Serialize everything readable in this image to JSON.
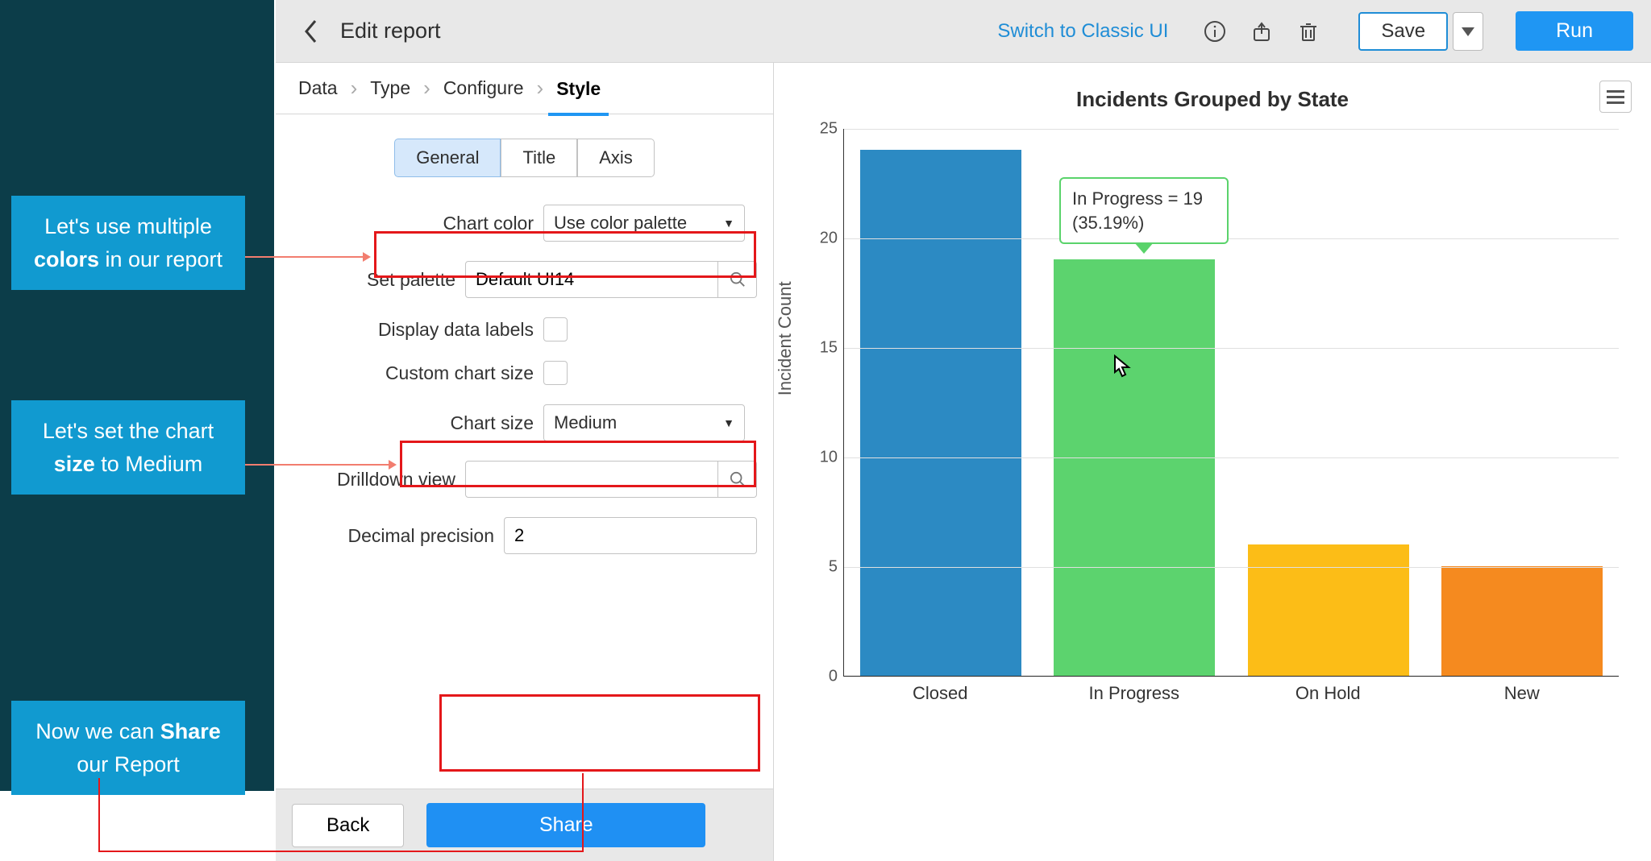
{
  "topbar": {
    "title": "Edit report",
    "classic_link": "Switch to Classic UI",
    "save_label": "Save",
    "run_label": "Run"
  },
  "wizard": {
    "tabs": [
      "Data",
      "Type",
      "Configure",
      "Style"
    ],
    "active": 3
  },
  "sub_tabs": {
    "items": [
      "General",
      "Title",
      "Axis"
    ],
    "active": 0
  },
  "fields": {
    "chart_color_label": "Chart color",
    "chart_color_value": "Use color palette",
    "set_palette_label": "Set palette",
    "set_palette_value": "Default UI14",
    "display_labels_label": "Display data labels",
    "custom_size_label": "Custom chart size",
    "chart_size_label": "Chart size",
    "chart_size_value": "Medium",
    "drilldown_label": "Drilldown view",
    "drilldown_value": "",
    "decimal_label": "Decimal precision",
    "decimal_value": "2"
  },
  "footer": {
    "back_label": "Back",
    "share_label": "Share"
  },
  "chart_title": "Incidents Grouped by State",
  "y_axis": "Incident Count",
  "chart_data": {
    "type": "bar",
    "title": "Incidents Grouped by State",
    "ylabel": "Incident Count",
    "ylim": [
      0,
      25
    ],
    "yticks": [
      0,
      5,
      10,
      15,
      20,
      25
    ],
    "categories": [
      "Closed",
      "In Progress",
      "On Hold",
      "New"
    ],
    "values": [
      24,
      19,
      6,
      5
    ],
    "colors": [
      "#2c8ac3",
      "#5cd36e",
      "#fcbd17",
      "#f58a1f"
    ],
    "tooltip": {
      "index": 1,
      "line1": "In Progress = 19",
      "line2": "(35.19%)"
    }
  },
  "callouts": {
    "c1_a": "Let's use multiple ",
    "c1_b": "colors",
    "c1_c": " in our report",
    "c2_a": "Let's set the chart ",
    "c2_b": "size",
    "c2_c": " to Medium",
    "c3_a": "Now we can ",
    "c3_b": "Share",
    "c3_c": " our Report"
  }
}
